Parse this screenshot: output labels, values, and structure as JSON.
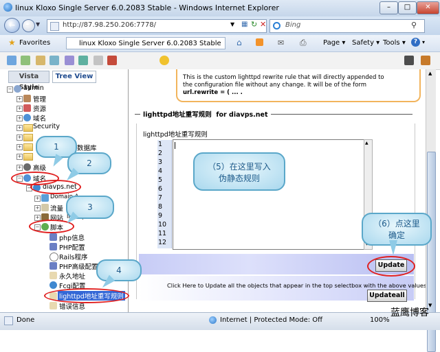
{
  "window": {
    "title": "linux Kloxo Single Server 6.0.2083 Stable - Windows Internet Explorer"
  },
  "address": {
    "url": "http://87.98.250.206:7778/",
    "search_placeholder": "Bing"
  },
  "favorites": {
    "label": "Favorites",
    "tab_title": "linux Kloxo Single Server 6.0.2083 Stable"
  },
  "commandbar": {
    "page": "Page",
    "safety": "Safety",
    "tools": "Tools",
    "help": "?"
  },
  "left": {
    "tabs": [
      "Vista Style",
      "Tree View"
    ],
    "tree": [
      "admin",
      "管理",
      "资源",
      "域名",
      "Security",
      "",
      "",
      "数据库",
      "",
      "高级",
      "域名",
      "diavps.net",
      "Domain A",
      "流量",
      "网站",
      "lighttpd",
      "脚本",
      "php信息",
      "PHP配置",
      "Rails程序",
      "PHP高级配置",
      "永久地址",
      "Fcgi配置",
      "lighttpd地址重写规则",
      "错误信息"
    ]
  },
  "content": {
    "info_lines": [
      "This is the custom lighttpd rewrite rule that will directly appended to",
      "the configuration file without any change. It will be of the form",
      "url.rewrite = ( ... ."
    ],
    "section_title": "lighttpd地址重写规则",
    "section_for": "for diavps.net",
    "field_label": "lighttpd地址重写规则",
    "line_numbers": [
      "1",
      "2",
      "3",
      "4",
      "5",
      "6",
      "7",
      "8",
      "9",
      "10",
      "11",
      "12"
    ],
    "update_label": "Update",
    "updateall_note": "Click Here to Update all the objects that appear in the top selectbox with the above values",
    "updateall_label": "Updateall"
  },
  "annotations": {
    "b1": "1",
    "b2": "2",
    "b3": "3",
    "b4": "4",
    "step5": [
      "（5）在这里写入",
      "伪静态规则"
    ],
    "step6": [
      "（6）点这里",
      "确定"
    ]
  },
  "status": {
    "left": "Done",
    "zone": "Internet | Protected Mode: Off",
    "zoom": "100%"
  },
  "watermark": "蓝鹰博客",
  "colors": {
    "bubble_border": "#5aa7c9",
    "ring": "#e02020",
    "stripe": "#c7ccf6",
    "selected": "#3367d6"
  }
}
